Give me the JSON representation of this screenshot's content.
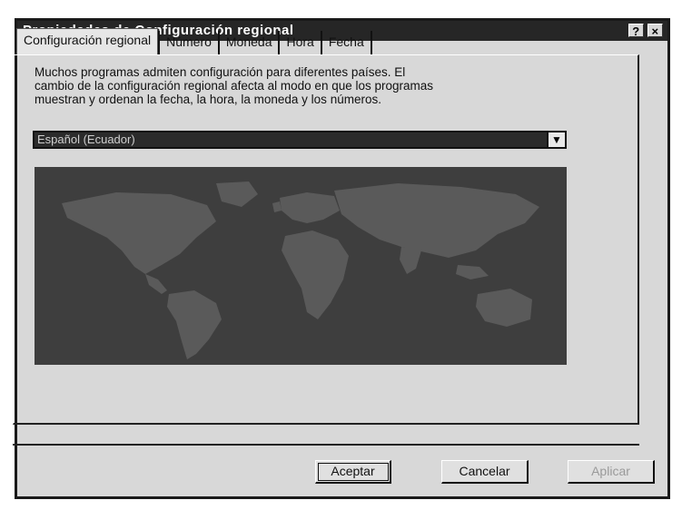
{
  "window": {
    "title": "Propiedades de Configuración regional",
    "help_button": "?",
    "close_button": "×"
  },
  "tabs": [
    {
      "label": "Configuración regional",
      "selected": true
    },
    {
      "label": "Número",
      "selected": false
    },
    {
      "label": "Moneda",
      "selected": false
    },
    {
      "label": "Hora",
      "selected": false
    },
    {
      "label": "Fecha",
      "selected": false
    }
  ],
  "panel": {
    "description_lines": [
      "Muchos programas admiten configuración para diferentes países. El",
      "cambio de la configuración regional afecta al modo en que los programas",
      "muestran y ordenan la fecha, la hora, la moneda y los números."
    ],
    "locale_select": {
      "value": "Español (Ecuador)",
      "arrow_icon": "chevron-down-icon"
    },
    "map_icon": "world-map"
  },
  "buttons": {
    "accept": "Aceptar",
    "cancel": "Cancelar",
    "apply": "Aplicar"
  },
  "colors": {
    "titlebar": "#262626",
    "face": "#d8d8d8",
    "map_background": "#3e3e3e",
    "map_land": "#5a5a5a"
  }
}
